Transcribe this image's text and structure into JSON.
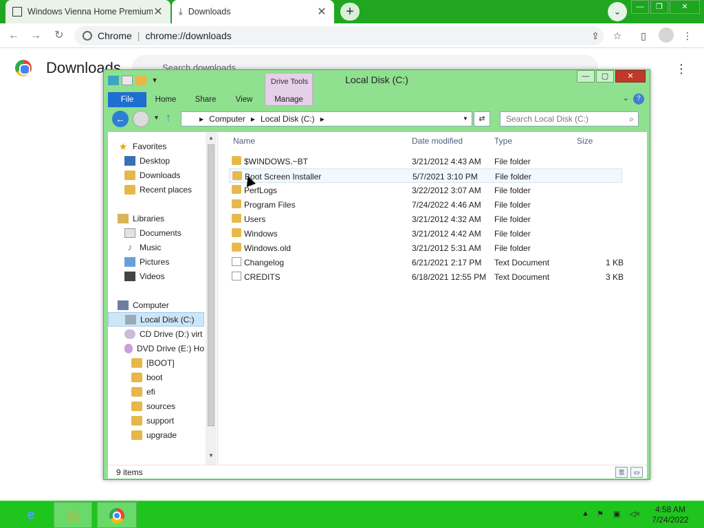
{
  "browser": {
    "tabs": [
      {
        "title": "Windows Vienna Home Premium",
        "active": false
      },
      {
        "title": "Downloads",
        "active": true
      }
    ],
    "new_tab": "+",
    "omnibox": {
      "scheme_label": "Chrome",
      "url": "chrome://downloads"
    },
    "page": {
      "title": "Downloads",
      "search_placeholder": "Search downloads"
    }
  },
  "explorer": {
    "title": "Local Disk (C:)",
    "ribbon": {
      "contextual_group": "Drive Tools",
      "tabs": [
        "File",
        "Home",
        "Share",
        "View",
        "Manage"
      ]
    },
    "address": {
      "crumbs": [
        "Computer",
        "Local Disk (C:)"
      ]
    },
    "search_placeholder": "Search Local Disk (C:)",
    "nav": [
      {
        "label": "Favorites",
        "icon": "star-icon"
      },
      {
        "label": "Desktop",
        "icon": "desktop-icon"
      },
      {
        "label": "Downloads",
        "icon": "downloads-folder-icon"
      },
      {
        "label": "Recent places",
        "icon": "recent-places-icon"
      },
      {
        "label": "Libraries",
        "icon": "libraries-icon"
      },
      {
        "label": "Documents",
        "icon": "documents-icon"
      },
      {
        "label": "Music",
        "icon": "music-icon"
      },
      {
        "label": "Pictures",
        "icon": "pictures-icon"
      },
      {
        "label": "Videos",
        "icon": "videos-icon"
      },
      {
        "label": "Computer",
        "icon": "computer-icon"
      },
      {
        "label": "Local Disk (C:)",
        "icon": "local-disk-icon",
        "selected": true
      },
      {
        "label": "CD Drive (D:) virt",
        "icon": "cd-drive-icon"
      },
      {
        "label": "DVD Drive (E:) Ho",
        "icon": "dvd-drive-icon"
      },
      {
        "label": "[BOOT]",
        "icon": "folder-icon"
      },
      {
        "label": "boot",
        "icon": "folder-icon"
      },
      {
        "label": "efi",
        "icon": "folder-icon"
      },
      {
        "label": "sources",
        "icon": "folder-icon"
      },
      {
        "label": "support",
        "icon": "folder-icon"
      },
      {
        "label": "upgrade",
        "icon": "folder-icon"
      }
    ],
    "columns": [
      "Name",
      "Date modified",
      "Type",
      "Size"
    ],
    "files": [
      {
        "name": "$WINDOWS.~BT",
        "date": "3/21/2012 4:43 AM",
        "type": "File folder",
        "size": ""
      },
      {
        "name": "Boot Screen Installer",
        "date": "5/7/2021 3:10 PM",
        "type": "File folder",
        "size": "",
        "hover": true
      },
      {
        "name": "PerfLogs",
        "date": "3/22/2012 3:07 AM",
        "type": "File folder",
        "size": ""
      },
      {
        "name": "Program Files",
        "date": "7/24/2022 4:46 AM",
        "type": "File folder",
        "size": ""
      },
      {
        "name": "Users",
        "date": "3/21/2012 4:32 AM",
        "type": "File folder",
        "size": ""
      },
      {
        "name": "Windows",
        "date": "3/21/2012 4:42 AM",
        "type": "File folder",
        "size": ""
      },
      {
        "name": "Windows.old",
        "date": "3/21/2012 5:31 AM",
        "type": "File folder",
        "size": ""
      },
      {
        "name": "Changelog",
        "date": "6/21/2021 2:17 PM",
        "type": "Text Document",
        "size": "1 KB"
      },
      {
        "name": "CREDITS",
        "date": "6/18/2021 12:55 PM",
        "type": "Text Document",
        "size": "3 KB"
      }
    ],
    "status": "9 items"
  },
  "taskbar": {
    "time": "4:58 AM",
    "date": "7/24/2022"
  },
  "colors": {
    "accent_green": "#21a621",
    "taskbar_green": "#1fc41f",
    "explorer_frame": "#8fe08f",
    "file_tab_blue": "#1e6fcf",
    "selection": "#cde6f7"
  }
}
